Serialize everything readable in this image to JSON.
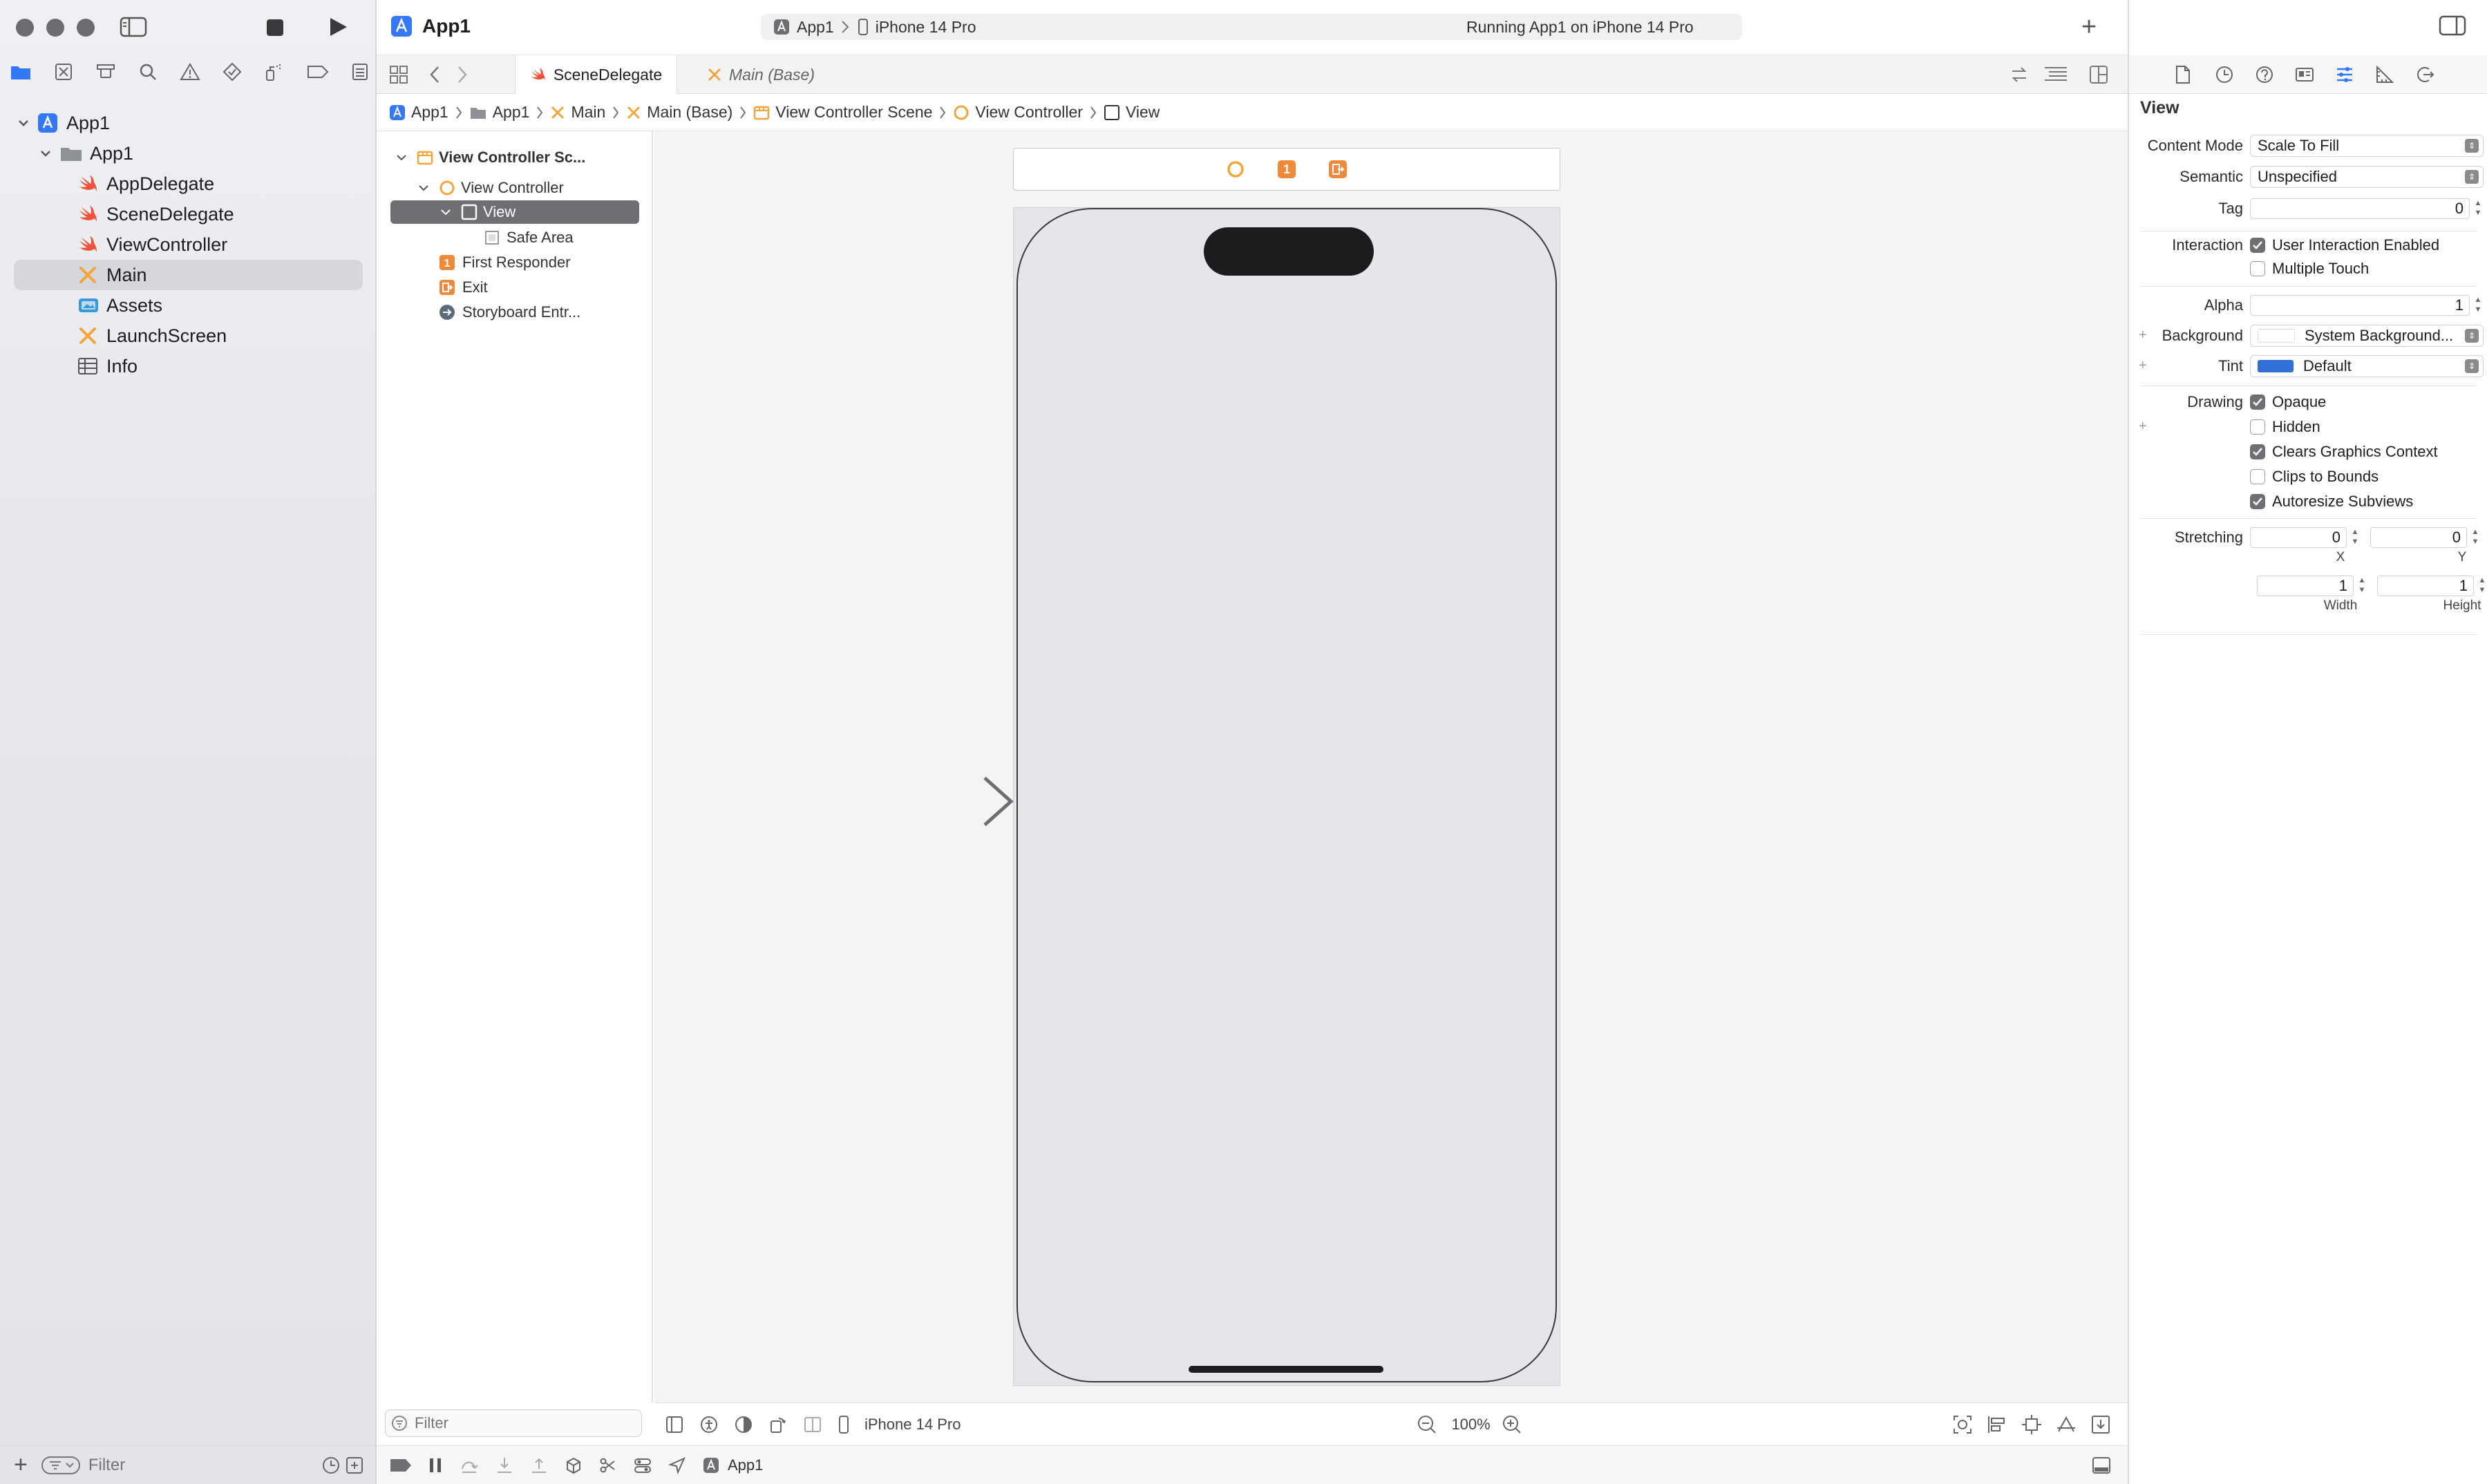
{
  "navigator": {
    "tree": [
      {
        "label": "App1",
        "icon": "app-project-icon"
      },
      {
        "label": "App1",
        "icon": "folder-icon"
      },
      {
        "label": "AppDelegate",
        "icon": "swift-file-icon"
      },
      {
        "label": "SceneDelegate",
        "icon": "swift-file-icon"
      },
      {
        "label": "ViewController",
        "icon": "swift-file-icon"
      },
      {
        "label": "Main",
        "icon": "storyboard-icon"
      },
      {
        "label": "Assets",
        "icon": "assets-icon"
      },
      {
        "label": "LaunchScreen",
        "icon": "storyboard-icon"
      },
      {
        "label": "Info",
        "icon": "plist-table-icon"
      }
    ],
    "filter_placeholder": "Filter"
  },
  "toolbar": {
    "project_title": "App1",
    "scheme": "App1",
    "device": "iPhone 14 Pro",
    "status": "Running App1 on iPhone 14 Pro"
  },
  "tabs": [
    {
      "label": "SceneDelegate",
      "icon": "swift-file-icon",
      "active": true
    },
    {
      "label": "Main (Base)",
      "icon": "storyboard-icon",
      "active": false
    }
  ],
  "jumpbar": [
    "App1",
    "App1",
    "Main",
    "Main (Base)",
    "View Controller Scene",
    "View Controller",
    "View"
  ],
  "outline": {
    "items": [
      {
        "label": "View Controller Sc..."
      },
      {
        "label": "View Controller"
      },
      {
        "label": "View"
      },
      {
        "label": "Safe Area"
      },
      {
        "label": "First Responder"
      },
      {
        "label": "Exit"
      },
      {
        "label": "Storyboard Entr..."
      }
    ],
    "filter_placeholder": "Filter"
  },
  "scene_dock": {
    "first_responder_glyph": "1"
  },
  "canvas_bar": {
    "device": "iPhone 14 Pro",
    "zoom": "100%"
  },
  "debugbar": {
    "target": "App1"
  },
  "inspector": {
    "title": "View",
    "content_mode_label": "Content Mode",
    "content_mode": "Scale To Fill",
    "semantic_label": "Semantic",
    "semantic": "Unspecified",
    "tag_label": "Tag",
    "tag": "0",
    "interaction_label": "Interaction",
    "user_interaction": "User Interaction Enabled",
    "multiple_touch": "Multiple Touch",
    "alpha_label": "Alpha",
    "alpha": "1",
    "background_label": "Background",
    "background": "System Background...",
    "tint_label": "Tint",
    "tint": "Default",
    "tint_color": "#2f6fd6",
    "drawing_label": "Drawing",
    "opaque": "Opaque",
    "hidden": "Hidden",
    "clears_context": "Clears Graphics Context",
    "clips_bounds": "Clips to Bounds",
    "autoresize": "Autoresize Subviews",
    "stretching_label": "Stretching",
    "stretch_x": "0",
    "stretch_y": "0",
    "stretch_w": "1",
    "stretch_h": "1",
    "x_label": "X",
    "y_label": "Y",
    "width_label": "Width",
    "height_label": "Height"
  },
  "colors": {
    "swift": "#f05138",
    "storyboard": "#f3a53a",
    "xcode_blue": "#3478f6",
    "selection": "#6e6e73"
  }
}
